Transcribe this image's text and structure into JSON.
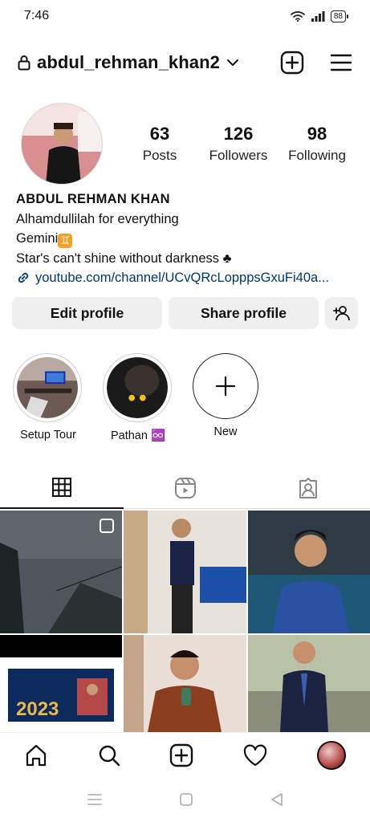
{
  "status": {
    "time": "7:46",
    "battery": "88"
  },
  "header": {
    "username": "abdul_rehman_khan2"
  },
  "stats": [
    {
      "value": "63",
      "label": "Posts"
    },
    {
      "value": "126",
      "label": "Followers"
    },
    {
      "value": "98",
      "label": "Following"
    }
  ],
  "bio": {
    "name": "ABDUL REHMAN KHAN",
    "line1": "Alhamdullilah for everything",
    "line2": "Gemini",
    "zodiac_symbol": "♊",
    "line3": "Star's can't shine without darkness ♣",
    "link": "youtube.com/channel/UCvQRcLopppsGxuFi40a..."
  },
  "buttons": {
    "edit": "Edit profile",
    "share": "Share profile"
  },
  "highlights": [
    {
      "label": "Setup Tour"
    },
    {
      "label": "Pathan ♾️"
    },
    {
      "label": "New"
    }
  ],
  "colors": {
    "link": "#00376b",
    "button_bg": "#efefef",
    "zodiac": "#f0a32a"
  },
  "icons": {
    "header": [
      "lock-icon",
      "chevron-down-icon",
      "new-post-icon",
      "menu-icon"
    ],
    "tabs": [
      "grid-icon",
      "reels-icon",
      "tagged-icon"
    ],
    "bottom_nav": [
      "home-icon",
      "search-icon",
      "create-icon",
      "heart-icon",
      "profile-avatar"
    ],
    "system_nav": [
      "recents-icon",
      "home-square-icon",
      "back-icon"
    ]
  }
}
